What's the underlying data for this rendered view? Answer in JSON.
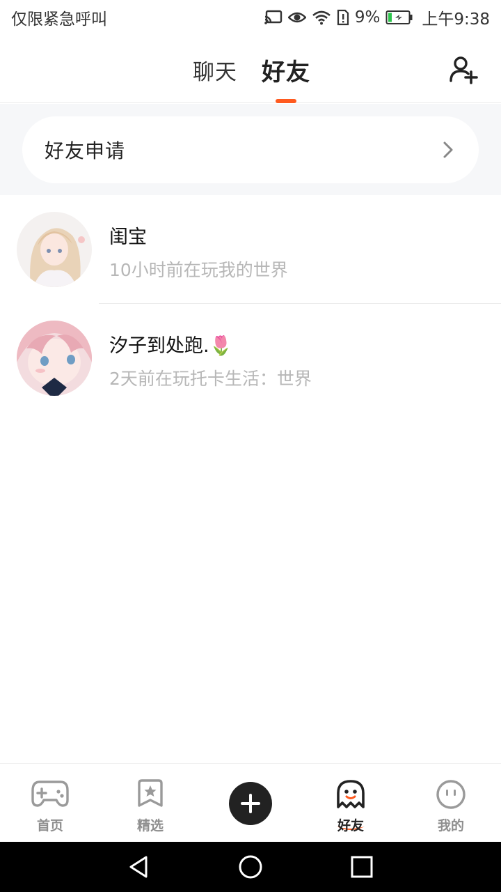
{
  "status_bar": {
    "carrier_text": "仅限紧急呼叫",
    "battery_percent": "9%",
    "time": "上午9:38",
    "icons": [
      "cast-icon",
      "eye-icon",
      "wifi-icon",
      "sim-alert-icon",
      "battery-charging-icon"
    ]
  },
  "header": {
    "tabs": [
      {
        "label": "聊天",
        "active": false
      },
      {
        "label": "好友",
        "active": true
      }
    ],
    "accent_color": "#ff5a1f",
    "action_icon": "add-friend-icon"
  },
  "friend_request": {
    "label": "好友申请",
    "icon": "chevron-right-icon"
  },
  "friends": [
    {
      "name": "闺宝",
      "status": "10小时前在玩我的世界",
      "avatar": "anime-girl-blonde-avatar"
    },
    {
      "name": "汐子到处跑.🌷",
      "status": "2天前在玩托卡生活：世界",
      "avatar": "anime-girl-pink-avatar"
    }
  ],
  "bottom_nav": {
    "items": [
      {
        "label": "首页",
        "icon": "gamepad-icon",
        "active": false
      },
      {
        "label": "精选",
        "icon": "bookmark-star-icon",
        "active": false
      },
      {
        "label": "",
        "icon": "plus-icon",
        "active": false
      },
      {
        "label": "好友",
        "icon": "ghost-icon",
        "active": true
      },
      {
        "label": "我的",
        "icon": "face-icon",
        "active": false
      }
    ]
  },
  "system_nav": {
    "icons": [
      "back-icon",
      "home-icon",
      "recents-icon"
    ]
  }
}
